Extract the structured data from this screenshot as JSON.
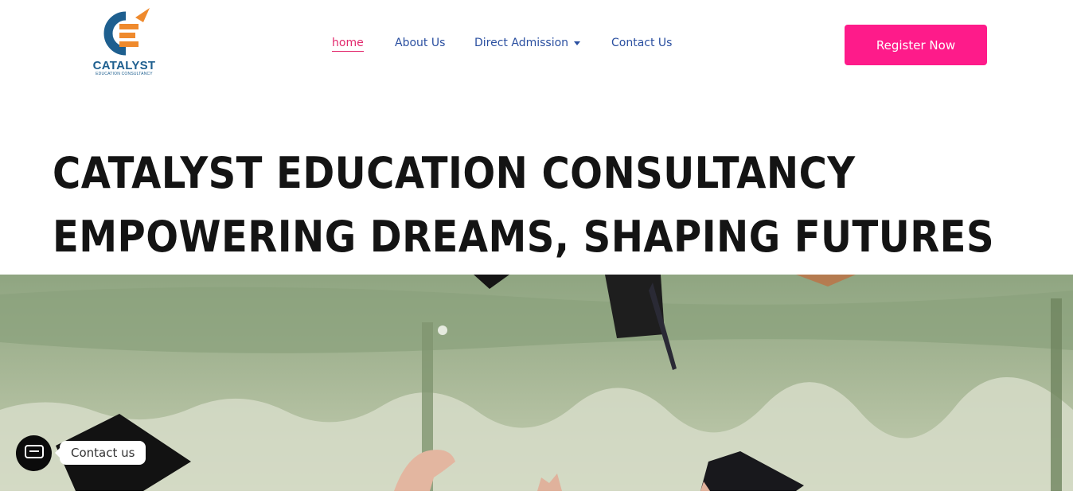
{
  "brand": {
    "name": "CATALYST",
    "tagline": "EDUCATION CONSULTANCY",
    "colors": {
      "teal": "#1e5f8f",
      "orange": "#ef8a2d"
    }
  },
  "nav": {
    "items": [
      {
        "label": "home",
        "active": true
      },
      {
        "label": "About Us",
        "active": false
      },
      {
        "label": "Direct Admission",
        "active": false,
        "has_dropdown": true
      },
      {
        "label": "Contact Us",
        "active": false
      }
    ]
  },
  "header": {
    "register_label": "Register Now",
    "register_color": "#fe1b8a"
  },
  "hero": {
    "title_line1": "CATALYST EDUCATION CONSULTANCY",
    "title_line2": "EMPOWERING DREAMS, SHAPING FUTURES"
  },
  "contact_widget": {
    "label": "Contact us",
    "icon": "chat-icon"
  },
  "colors": {
    "active_nav": "#e2296d",
    "nav_text": "#2a4fa0",
    "title_text": "#141414"
  }
}
